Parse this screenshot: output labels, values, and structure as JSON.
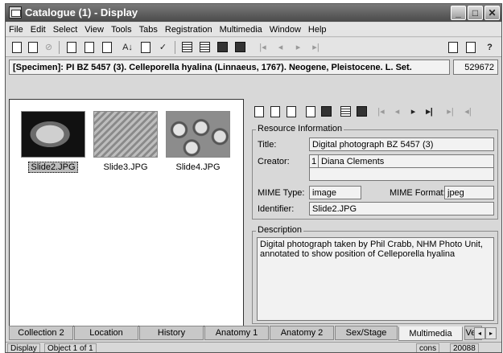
{
  "window": {
    "title": "Catalogue (1) - Display",
    "min": "_",
    "max": "□",
    "close": "✕"
  },
  "menu": [
    "File",
    "Edit",
    "Select",
    "View",
    "Tools",
    "Tabs",
    "Registration",
    "Multimedia",
    "Window",
    "Help"
  ],
  "record": {
    "title": "[Specimen]: PI BZ 5457 (3). Celleporella hyalina (Linnaeus, 1767). Neogene, Pleistocene. L. Set.",
    "id": "529672"
  },
  "thumbnails": [
    {
      "caption": "Slide2.JPG",
      "selected": true
    },
    {
      "caption": "Slide3.JPG",
      "selected": false
    },
    {
      "caption": "Slide4.JPG",
      "selected": false
    }
  ],
  "resource_info": {
    "group_label": "Resource Information",
    "title_label": "Title:",
    "title_value": "Digital photograph BZ 5457 (3)",
    "creator_label": "Creator:",
    "creator_index": "1",
    "creator_value": "Diana Clements",
    "mime_type_label": "MIME Type:",
    "mime_type_value": "image",
    "mime_format_label": "MIME Format:",
    "mime_format_value": "jpeg",
    "identifier_label": "Identifier:",
    "identifier_value": "Slide2.JPG"
  },
  "description": {
    "group_label": "Description",
    "text": "Digital photograph taken by Phil Crabb, NHM Photo Unit, annotated to show position of Celleporella hyalina"
  },
  "tabs": [
    "Collection 2",
    "Location",
    "History",
    "Anatomy 1",
    "Anatomy 2",
    "Sex/Stage",
    "Multimedia",
    "Veri"
  ],
  "active_tab": "Multimedia",
  "status": {
    "mode": "Display",
    "position": "Object 1 of 1",
    "user": "cons",
    "number": "20088"
  },
  "icons": {
    "nav_first": "|◂",
    "nav_prev": "◂",
    "nav_next": "▸",
    "nav_last": "▸|",
    "r_prev": "◂",
    "r_next": "▸",
    "r_last": "▸|",
    "r_end": "▸|",
    "r_back": "◂|",
    "sort": "A↓",
    "help": "⁉",
    "help_q": "?"
  }
}
